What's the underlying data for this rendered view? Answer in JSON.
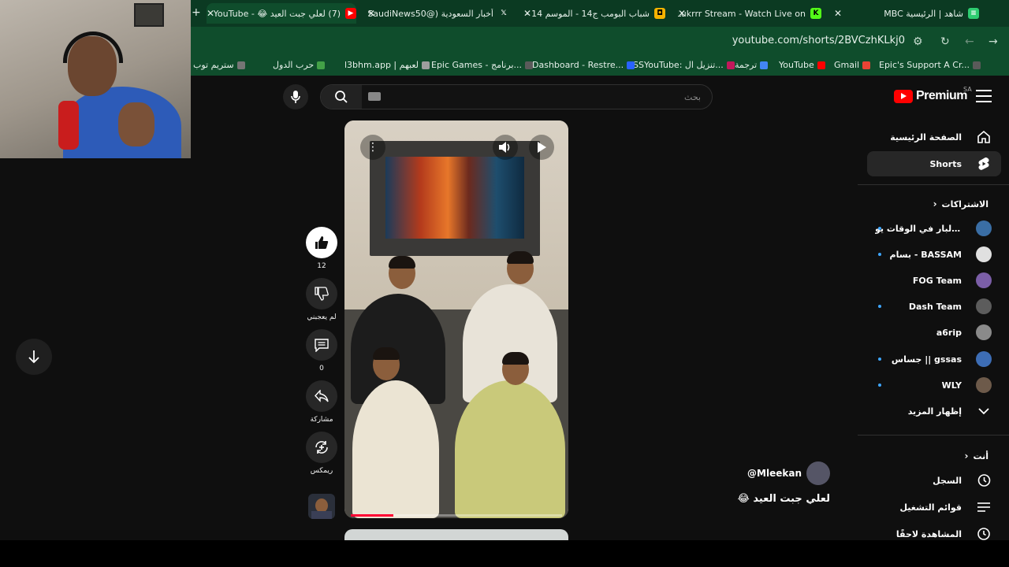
{
  "browser": {
    "tabs": [
      {
        "title": "شاهد | الرئيسية MBC",
        "favicon": "mbc-icon",
        "color": "#2ecc71"
      },
      {
        "title": "LaLukrrr Stream - Watch Live on",
        "favicon": "kick-icon",
        "color": "#53fc18"
      },
      {
        "title": "شباب البومب ج14 - الموسم 14 -",
        "favicon": "square-icon",
        "color": "#f5b300"
      },
      {
        "title": "أخبار السعودية (@SaudiNews50)",
        "favicon": "x-icon",
        "color": "#ffffff"
      },
      {
        "title": "(7) لعلي جبت العيد 😂 - YouTube",
        "favicon": "youtube-icon",
        "color": "#ff0000"
      }
    ],
    "url": "youtube.com/shorts/2BVCzhKLkj0",
    "bookmarks": [
      {
        "label": "Epic's Support A Cr...",
        "color": "#5a5a5a"
      },
      {
        "label": "Gmail",
        "color": "#ea4335"
      },
      {
        "label": "YouTube",
        "color": "#ff0000"
      },
      {
        "label": "ترجمة",
        "color": "#4285f4"
      },
      {
        "label": "SSYouTube: تنزيل ال...",
        "color": "#c2185b"
      },
      {
        "label": "Dashboard - Restre...",
        "color": "#2962ff"
      },
      {
        "label": "Epic Games - برنامج...",
        "color": "#5a5a5a"
      },
      {
        "label": "l3bhm.app | لعبهم",
        "color": "#9e9e9e"
      },
      {
        "label": "حرب الدول",
        "color": "#43a047"
      },
      {
        "label": "ستريم توب",
        "color": "#757575"
      }
    ]
  },
  "youtube": {
    "logo_text": "Premium",
    "country_code": "SA",
    "search": {
      "placeholder": "بحث"
    },
    "sidebar": {
      "home": "الصفحة الرئيسية",
      "shorts": "Shorts",
      "subscriptions_heading": "الاشتراكات",
      "subscriptions": [
        {
          "name": "حسين البار في الوقات يو...",
          "live": true,
          "color": "#3a6ea5"
        },
        {
          "name": "بسام - BASSAM",
          "live": true,
          "color": "#e0e0e0"
        },
        {
          "name": "FOG Team",
          "live": false,
          "color": "#7b5ea7"
        },
        {
          "name": "Dash Team",
          "live": true,
          "color": "#5c5c5c"
        },
        {
          "name": "a6rip",
          "live": false,
          "color": "#8a8a8a"
        },
        {
          "name": "جساس || gssas",
          "live": true,
          "color": "#3d6db5"
        },
        {
          "name": "WLY",
          "live": true,
          "color": "#6d5a4a"
        }
      ],
      "show_more": "إظهار المزيد",
      "you_heading": "أنت",
      "history": "السجل",
      "playlists": "قوائم التشغيل",
      "watch_later": "المشاهدة لاحقًا"
    },
    "short": {
      "channel": "@Mleekan",
      "title": "لعلي جبت العيد 😂",
      "likes": "12",
      "dislike_label": "لم يعجبني",
      "comments": "0",
      "share_label": "مشاركة",
      "remix_label": "ريمكس",
      "progress": 0.2
    }
  }
}
